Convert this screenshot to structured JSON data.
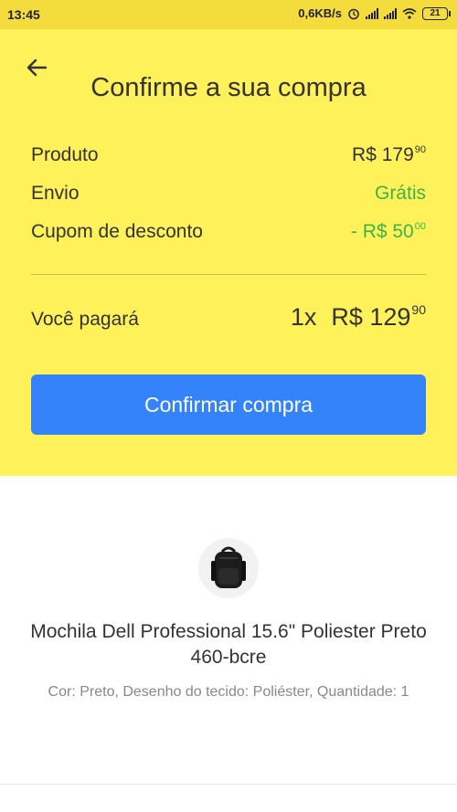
{
  "status_bar": {
    "time": "13:45",
    "speed": "0,6KB/s",
    "battery": "21"
  },
  "header": {
    "title": "Confirme a sua compra"
  },
  "summary": {
    "product_label": "Produto",
    "product_price_main": "R$ 179",
    "product_price_cents": "90",
    "shipping_label": "Envio",
    "shipping_value": "Grátis",
    "coupon_label": "Cupom de desconto",
    "coupon_main": "- R$ 50",
    "coupon_cents": "00"
  },
  "total": {
    "label": "Você pagará",
    "installments": "1x",
    "price_main": "R$ 129",
    "price_cents": "90"
  },
  "cta": {
    "label": "Confirmar compra"
  },
  "product": {
    "name": "Mochila Dell Professional 15.6\" Poliester Preto 460-bcre",
    "attributes": "Cor: Preto, Desenho do tecido: Poliéster, Quantidade: 1"
  },
  "colors": {
    "header_bg": "#fff159",
    "button": "#3483fa",
    "green": "#3bb54a"
  }
}
